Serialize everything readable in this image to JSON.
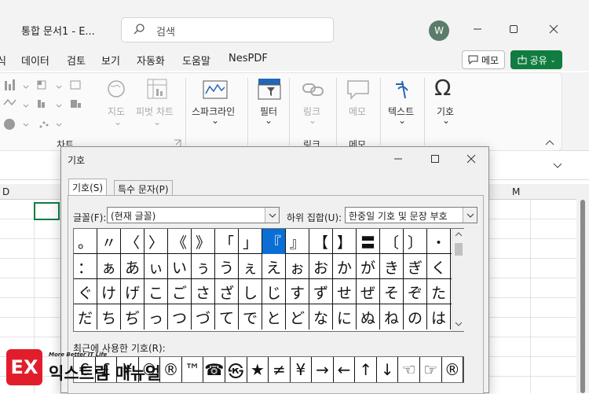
{
  "window": {
    "title": "통합 문서1  -  E...",
    "search_placeholder": "검색",
    "avatar_initial": "W"
  },
  "menu": {
    "items": [
      "식",
      "데이터",
      "검토",
      "보기",
      "자동화",
      "도움말",
      "NesPDF"
    ],
    "memo_label": "메모",
    "share_label": "공유"
  },
  "ribbon": {
    "charts_group": "차트",
    "buttons": {
      "map": "지도",
      "pivot_chart": "피벗 차트",
      "sparkline": "스파크라인",
      "filter": "필터",
      "link": "링크",
      "memo": "메모",
      "text": "텍스트",
      "symbol": "기호"
    },
    "groups": {
      "link": "링크",
      "memo": "메모"
    }
  },
  "sheet": {
    "col_d": "D",
    "col_m": "M"
  },
  "dialog": {
    "title": "기호",
    "tabs": [
      "기호(S)",
      "특수 문자(P)"
    ],
    "font_label": "글꼴(F):",
    "font_value": "(현재 글꼴)",
    "subset_label": "하위 집합(U):",
    "subset_value": "한중일 기호 및 문장 부호",
    "symbol_rows": [
      [
        "。",
        "〃",
        "〈",
        "〉",
        "《",
        "》",
        "「",
        "」",
        "『",
        "』",
        "【",
        "】",
        "〓",
        "〔",
        "〕",
        "・"
      ],
      [
        "：",
        "ぁ",
        "あ",
        "ぃ",
        "い",
        "ぅ",
        "う",
        "ぇ",
        "え",
        "ぉ",
        "お",
        "か",
        "が",
        "き",
        "ぎ",
        "く"
      ],
      [
        "ぐ",
        "け",
        "げ",
        "こ",
        "ご",
        "さ",
        "ざ",
        "し",
        "じ",
        "す",
        "ず",
        "せ",
        "ぜ",
        "そ",
        "ぞ",
        "た"
      ],
      [
        "だ",
        "ち",
        "ぢ",
        "っ",
        "つ",
        "づ",
        "て",
        "で",
        "と",
        "ど",
        "な",
        "に",
        "ぬ",
        "ね",
        "の",
        "は"
      ]
    ],
    "selected_symbol": "『",
    "recent_label": "최근에 사용한 기호(R):",
    "recent_symbols": [
      "€",
      "£",
      "¥",
      "©",
      "®",
      "™",
      "☎",
      "㉿",
      "★",
      "≠",
      "¥",
      "→",
      "←",
      "↑",
      "↓",
      "☜",
      "☞",
      "®"
    ]
  },
  "watermark": {
    "tagline": "More Better IT Life",
    "name": "익스트림 매뉴얼",
    "mark": "EX"
  }
}
